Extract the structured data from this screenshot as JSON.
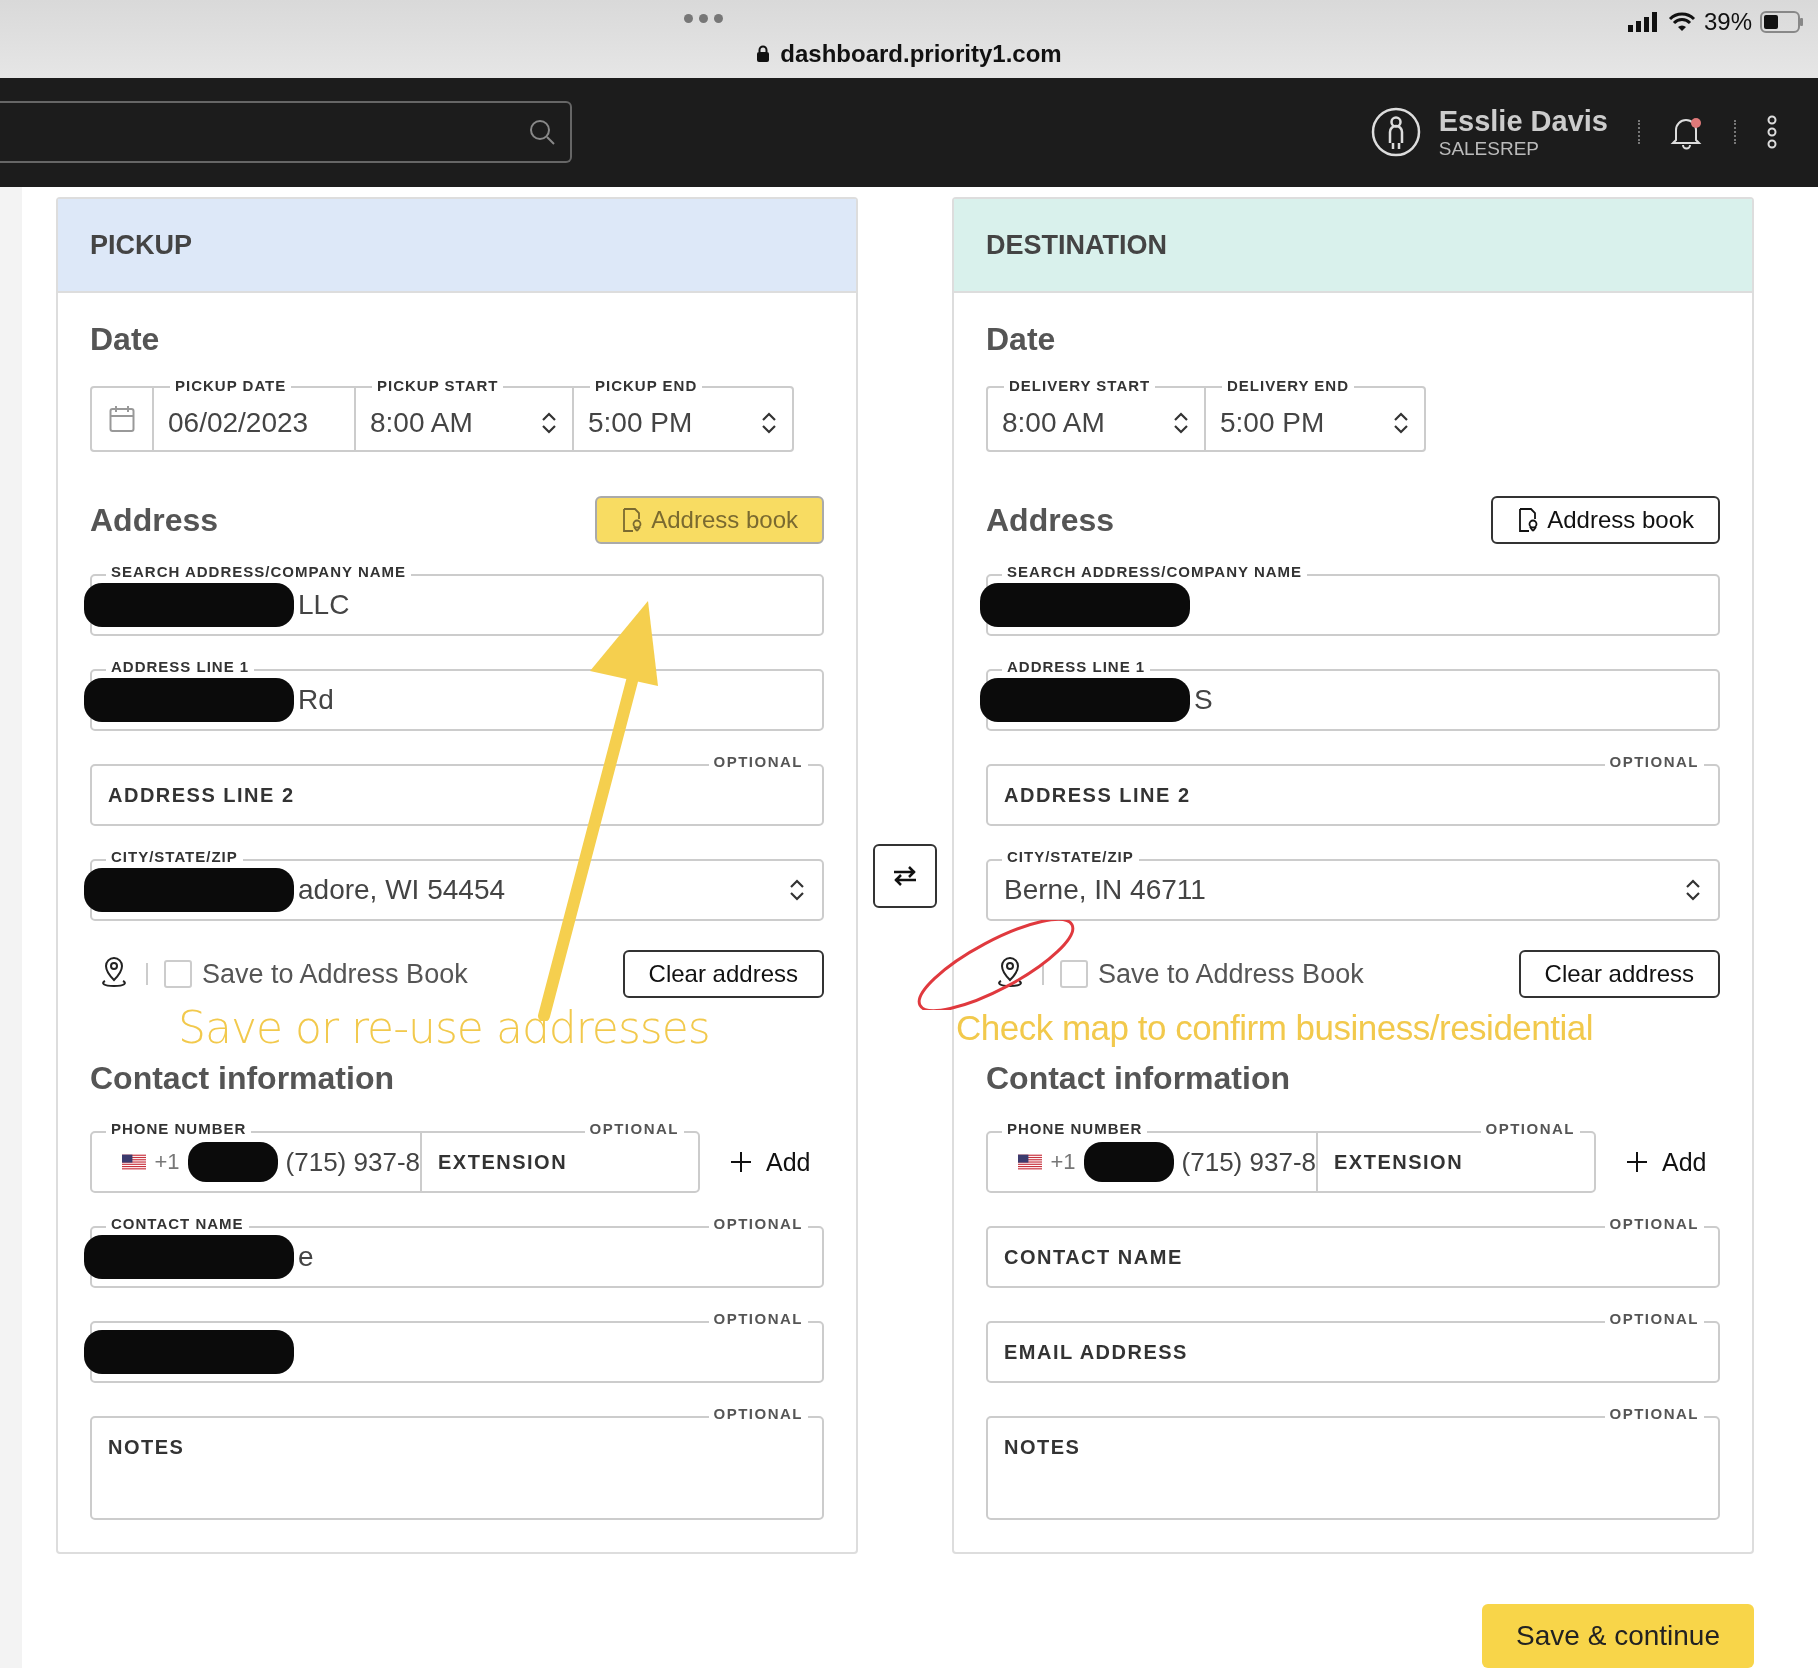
{
  "browser": {
    "url": "dashboard.priority1.com",
    "battery": "39%"
  },
  "header": {
    "user": {
      "name": "Esslie Davis",
      "role": "SALESREP"
    },
    "unread_notifications": true
  },
  "panels": [
    {
      "kind": "pickup",
      "title": "PICKUP",
      "date_heading": "Date",
      "date_fields": [
        {
          "kind": "date",
          "label": "PICKUP DATE",
          "value": "06/02/2023"
        },
        {
          "kind": "time",
          "label": "PICKUP START",
          "value": "8:00 AM"
        },
        {
          "kind": "time",
          "label": "PICKUP END",
          "value": "5:00 PM"
        }
      ],
      "address_heading": "Address",
      "address_book": {
        "label": "Address book",
        "highlighted": true
      },
      "address_fields": [
        {
          "kind": "text",
          "label": "SEARCH ADDRESS/COMPANY NAME",
          "value": "LLC",
          "redacted": true
        },
        {
          "kind": "text",
          "label": "ADDRESS LINE 1",
          "value": "Rd",
          "redacted": true
        },
        {
          "kind": "text",
          "placeholder": "ADDRESS LINE 2",
          "optional": "OPTIONAL",
          "redacted": false
        },
        {
          "kind": "select",
          "label": "CITY/STATE/ZIP",
          "value": "adore, WI 54454",
          "redacted": true
        }
      ],
      "save_to_book": {
        "label": "Save to Address Book",
        "checked": false
      },
      "clear_button": "Clear address",
      "annotation": {
        "text": "Save or re-use addresses",
        "arrow": true,
        "circled_map_pin": false
      },
      "contact_heading": "Contact information",
      "phone": {
        "label": "PHONE NUMBER",
        "code": "+1",
        "value": "(715) 937-8",
        "redacted": true,
        "extension_placeholder": "EXTENSION",
        "optional": "OPTIONAL"
      },
      "add_button": "Add",
      "contact_fields": [
        {
          "kind": "text",
          "label": "CONTACT NAME",
          "value": "e",
          "optional": "OPTIONAL",
          "redacted": true
        },
        {
          "kind": "text",
          "optional": "OPTIONAL",
          "redacted": true
        },
        {
          "kind": "notes",
          "placeholder": "NOTES",
          "optional": "OPTIONAL",
          "redacted": false
        }
      ]
    },
    {
      "kind": "destination",
      "title": "DESTINATION",
      "date_heading": "Date",
      "date_fields": [
        {
          "kind": "time",
          "label": "DELIVERY START",
          "value": "8:00 AM"
        },
        {
          "kind": "time",
          "label": "DELIVERY END",
          "value": "5:00 PM"
        }
      ],
      "address_heading": "Address",
      "address_book": {
        "label": "Address book",
        "highlighted": false
      },
      "address_fields": [
        {
          "kind": "text",
          "label": "SEARCH ADDRESS/COMPANY NAME",
          "redacted": true
        },
        {
          "kind": "text",
          "label": "ADDRESS LINE 1",
          "value": "S",
          "redacted": true
        },
        {
          "kind": "text",
          "placeholder": "ADDRESS LINE 2",
          "optional": "OPTIONAL",
          "redacted": false
        },
        {
          "kind": "select",
          "label": "CITY/STATE/ZIP",
          "value": "Berne, IN 46711",
          "redacted": false
        }
      ],
      "save_to_book": {
        "label": "Save to Address Book",
        "checked": false
      },
      "clear_button": "Clear address",
      "annotation": {
        "text": "Check map to confirm business/residential",
        "arrow": false,
        "circled_map_pin": true
      },
      "contact_heading": "Contact information",
      "phone": {
        "label": "PHONE NUMBER",
        "code": "+1",
        "value": "(715) 937-8",
        "redacted": true,
        "extension_placeholder": "EXTENSION",
        "optional": "OPTIONAL"
      },
      "add_button": "Add",
      "contact_fields": [
        {
          "kind": "text",
          "placeholder": "CONTACT NAME",
          "optional": "OPTIONAL",
          "redacted": false
        },
        {
          "kind": "text",
          "placeholder": "EMAIL ADDRESS",
          "optional": "OPTIONAL",
          "redacted": false
        },
        {
          "kind": "notes",
          "placeholder": "NOTES",
          "optional": "OPTIONAL",
          "redacted": false
        }
      ]
    }
  ],
  "save_button": "Save & continue"
}
